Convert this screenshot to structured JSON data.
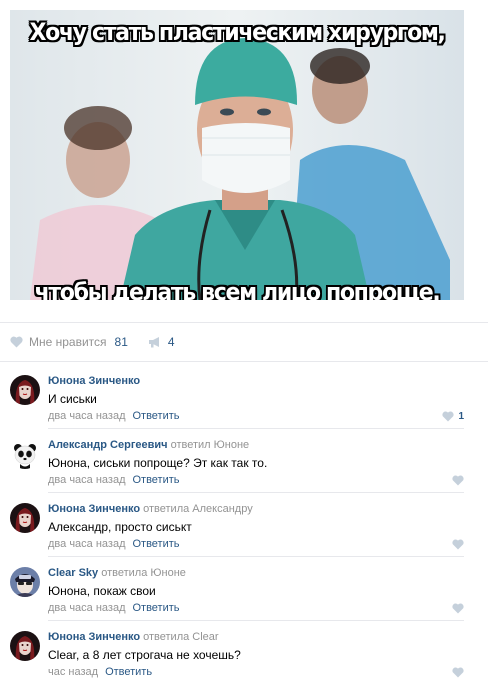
{
  "post": {
    "meme_top": "Хочу стать пластическим хирургом,",
    "meme_bottom": "чтобы делать всем лицо попроще.",
    "like_label": "Мне нравится",
    "like_count": "81",
    "share_count": "4"
  },
  "comments": [
    {
      "author": "Юнона Зинченко",
      "reply_word": "",
      "reply_target": "",
      "text": "И сиськи",
      "time": "два часа назад",
      "reply_label": "Ответить",
      "likes": "1"
    },
    {
      "author": "Александр Сергеевич",
      "reply_word": "ответил",
      "reply_target": "Юноне",
      "text": "Юнона, сиськи попроще? Эт как так то.",
      "time": "два часа назад",
      "reply_label": "Ответить",
      "likes": ""
    },
    {
      "author": "Юнона Зинченко",
      "reply_word": "ответила",
      "reply_target": "Александру",
      "text": "Александр, просто сиськт",
      "time": "два часа назад",
      "reply_label": "Ответить",
      "likes": ""
    },
    {
      "author": "Clear Sky",
      "reply_word": "ответила",
      "reply_target": "Юноне",
      "text": "Юнона, покаж свои",
      "time": "два часа назад",
      "reply_label": "Ответить",
      "likes": ""
    },
    {
      "author": "Юнона Зинченко",
      "reply_word": "ответила",
      "reply_target": "Clear",
      "text": "Clear, а 8 лет строгача не хочешь?",
      "time": "час назад",
      "reply_label": "Ответить",
      "likes": ""
    }
  ],
  "colors": {
    "link": "#2a5885",
    "meta": "#939393",
    "icon": "#c5d0db",
    "divider": "#e7e8ec"
  },
  "icons": {
    "like": "heart-icon",
    "share": "megaphone-icon"
  }
}
